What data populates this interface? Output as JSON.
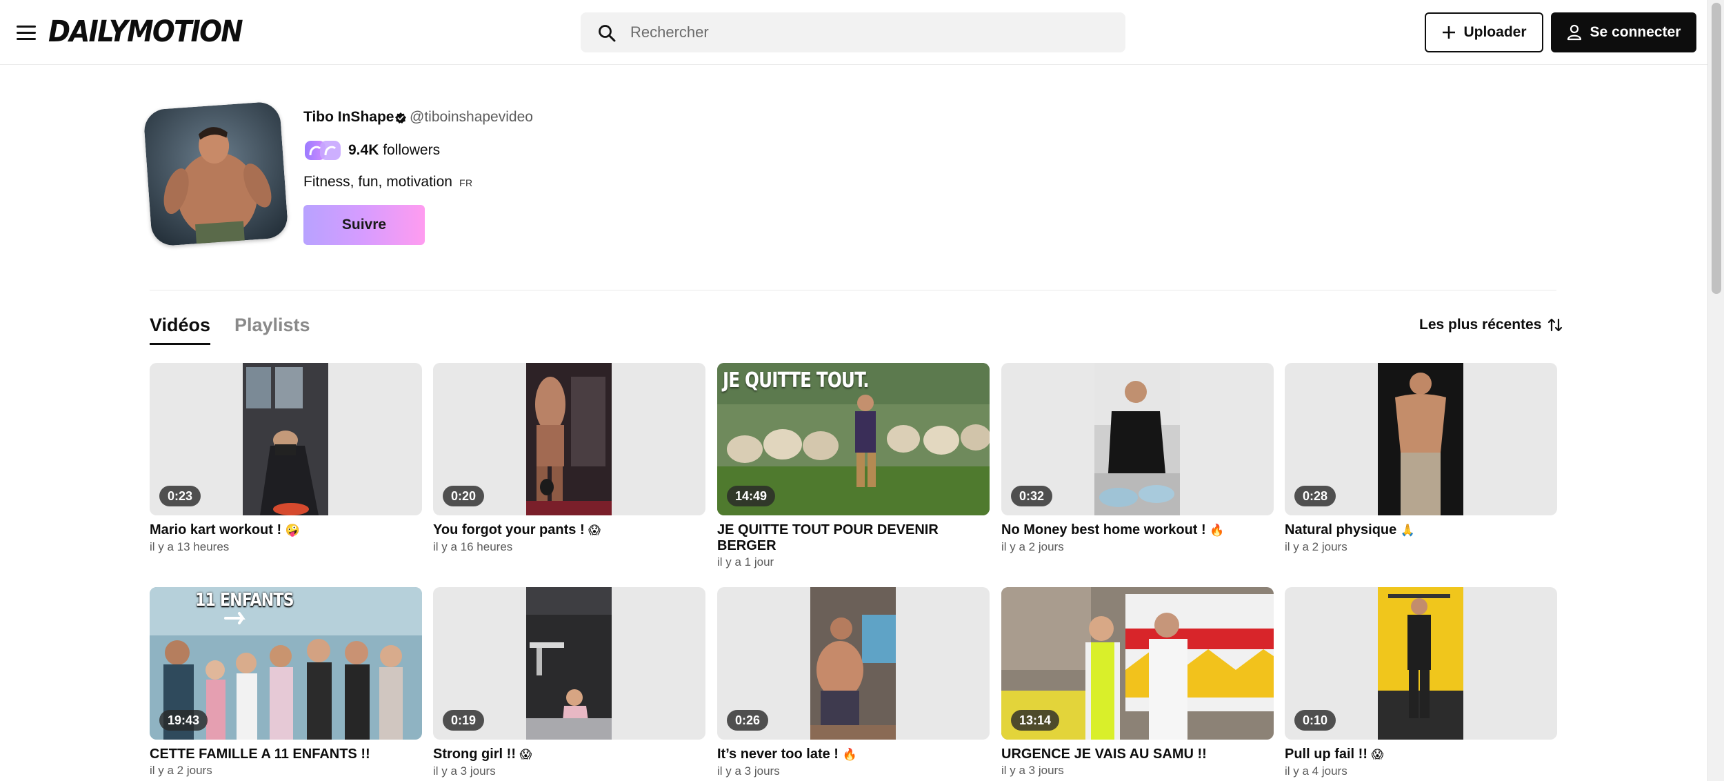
{
  "header": {
    "logo_text": "DAILYMOTION",
    "search_placeholder": "Rechercher",
    "upload_label": "Uploader",
    "login_label": "Se connecter"
  },
  "channel": {
    "name": "Tibo InShape",
    "handle": "@tiboinshapevideo",
    "followers_count": "9.4K",
    "followers_label": "followers",
    "bio": "Fitness, fun, motivation",
    "language": "FR",
    "follow_label": "Suivre"
  },
  "tabs": {
    "videos": "Vidéos",
    "playlists": "Playlists",
    "active": "Vidéos"
  },
  "sort": {
    "label": "Les plus récentes"
  },
  "videos": [
    {
      "title": "Mario kart workout !",
      "emoji": "🤪",
      "duration": "0:23",
      "date": "il y a 13 heures"
    },
    {
      "title": "You forgot your pants !",
      "emoji": "😱",
      "duration": "0:20",
      "date": "il y a 16 heures"
    },
    {
      "title": "JE QUITTE TOUT POUR DEVENIR BERGER",
      "emoji": "",
      "duration": "14:49",
      "date": "il y a 1 jour"
    },
    {
      "title": "No Money best home workout !",
      "emoji": "🔥",
      "duration": "0:32",
      "date": "il y a 2 jours"
    },
    {
      "title": "Natural physique",
      "emoji": "🙏",
      "duration": "0:28",
      "date": "il y a 2 jours"
    },
    {
      "title": "CETTE FAMILLE A 11 ENFANTS !!",
      "emoji": "",
      "duration": "19:43",
      "date": "il y a 2 jours"
    },
    {
      "title": "Strong girl !!",
      "emoji": "😱",
      "duration": "0:19",
      "date": "il y a 3 jours"
    },
    {
      "title": "It’s never too late !",
      "emoji": "🔥",
      "duration": "0:26",
      "date": "il y a 3 jours"
    },
    {
      "title": "URGENCE JE VAIS AU SAMU !!",
      "emoji": "",
      "duration": "13:14",
      "date": "il y a 3 jours"
    },
    {
      "title": "Pull up fail !!",
      "emoji": "😱",
      "duration": "0:10",
      "date": "il y a 4 jours"
    }
  ],
  "thumbnail_text": {
    "video_3": "JE QUITTE TOUT.",
    "video_6": "11 ENFANTS"
  },
  "colors": {
    "accent_gradient_start": "#b8a2ff",
    "accent_gradient_end": "#ff9cf0",
    "primary_dark": "#0d0d0d",
    "thumb_placeholder": "#e8e8e8"
  }
}
